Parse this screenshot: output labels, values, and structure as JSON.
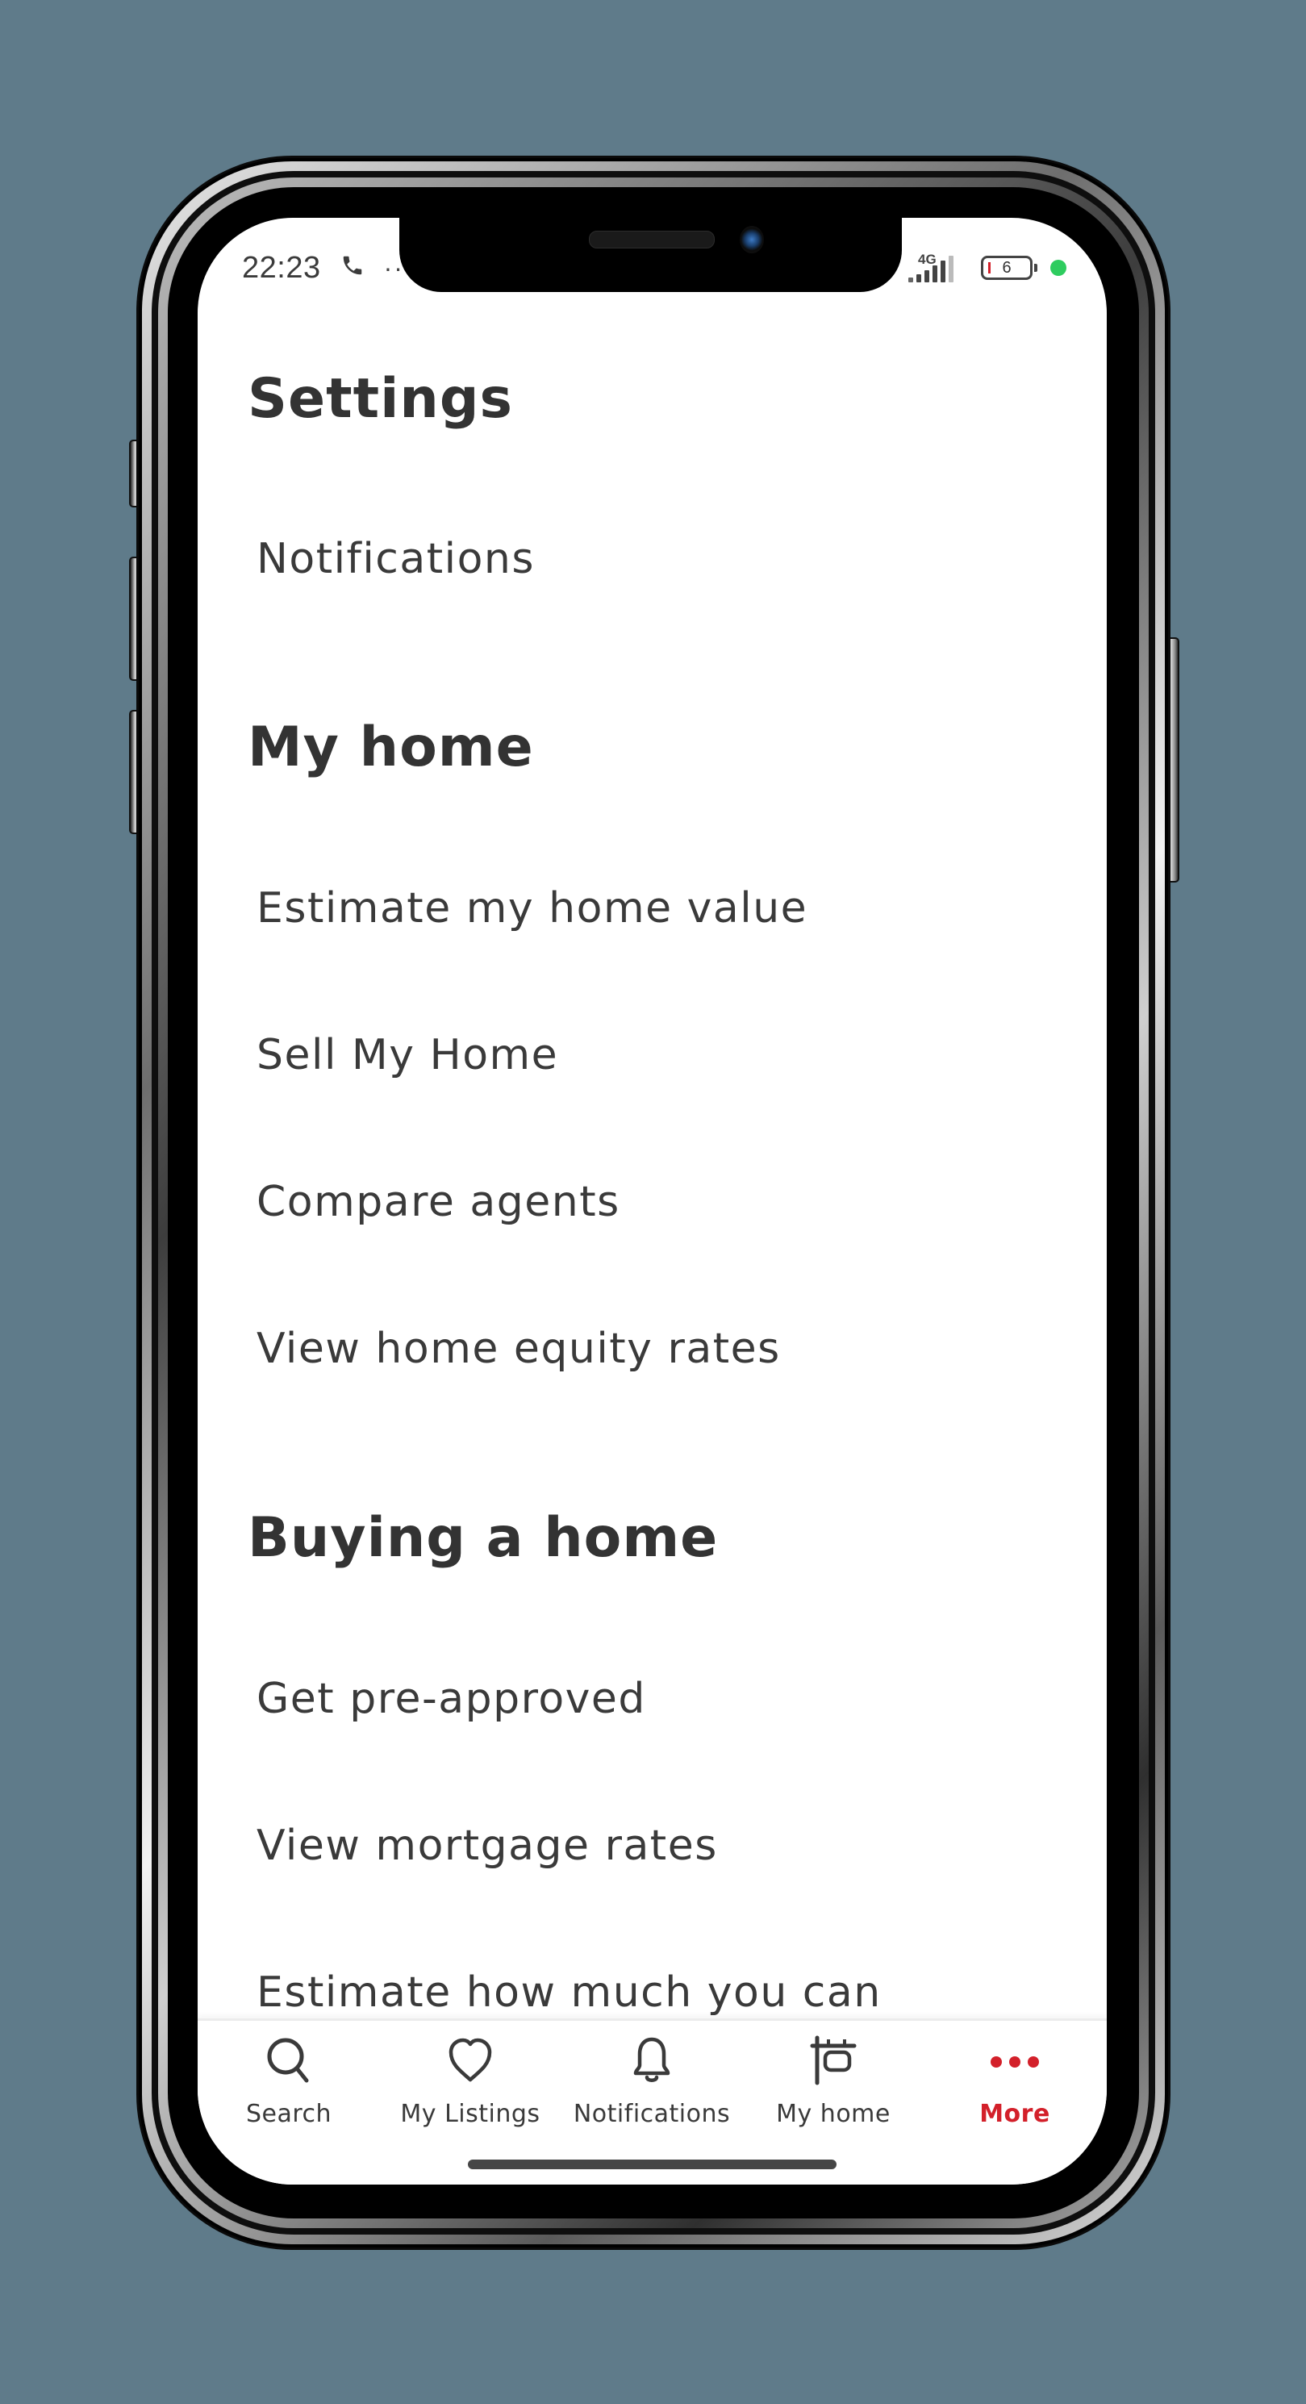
{
  "status_bar": {
    "time": "22:23",
    "call_icon": "phone-icon",
    "more_indicator": "··",
    "network_label": "4G",
    "battery_level": "6",
    "battery_low_color": "#d3202a",
    "active_dot_color": "#2ecc5f"
  },
  "sections": [
    {
      "title": "Settings",
      "items": [
        {
          "label": "Notifications"
        }
      ]
    },
    {
      "title": "My home",
      "items": [
        {
          "label": "Estimate my home value"
        },
        {
          "label": "Sell My Home"
        },
        {
          "label": "Compare agents"
        },
        {
          "label": "View home equity rates"
        }
      ]
    },
    {
      "title": "Buying a home",
      "items": [
        {
          "label": "Get pre-approved"
        },
        {
          "label": "View mortgage rates"
        },
        {
          "label": "Estimate how much you can"
        }
      ]
    }
  ],
  "tabbar": {
    "active_color": "#d3202a",
    "tabs": [
      {
        "label": "Search",
        "icon": "search-icon",
        "active": false
      },
      {
        "label": "My Listings",
        "icon": "heart-icon",
        "active": false
      },
      {
        "label": "Notifications",
        "icon": "bell-icon",
        "active": false
      },
      {
        "label": "My home",
        "icon": "home-sign-icon",
        "active": false
      },
      {
        "label": "More",
        "icon": "more-dots-icon",
        "active": true
      }
    ]
  },
  "colors": {
    "background": "#5f7b8a",
    "text_primary": "#333333",
    "accent": "#d3202a"
  }
}
